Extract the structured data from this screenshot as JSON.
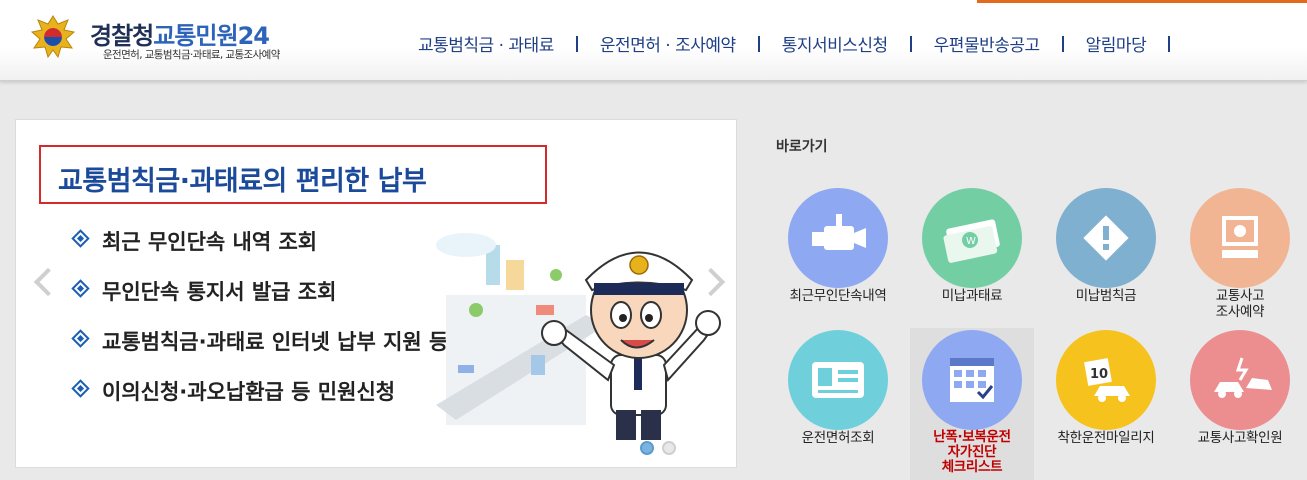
{
  "header": {
    "logo_main": "경찰청",
    "logo_accent": "교통민원24",
    "logo_subtitle": "운전면허, 교통범칙금·과태료, 교통조사예약",
    "nav": [
      "교통범칙금 · 과태료",
      "운전면허 · 조사예약",
      "통지서비스신청",
      "우편물반송공고",
      "알림마당"
    ]
  },
  "banner": {
    "title": "교통범칙금·과태료의 편리한 납부",
    "bullets": [
      "최근 무인단속 내역 조회",
      "무인단속 통지서 발급 조회",
      "교통범칙금·과태료 인터넷 납부 지원 등",
      "이의신청·과오납환급 등 민원신청"
    ],
    "slide_current": 1,
    "slide_total": 2
  },
  "quick": {
    "title": "바로가기",
    "items": [
      {
        "label": "최근무인단속내역",
        "icon": "camera-icon",
        "color": "#8ea8f2"
      },
      {
        "label": "미납과태료",
        "icon": "money-icon",
        "color": "#74cea4"
      },
      {
        "label": "미납범칙금",
        "icon": "warning-icon",
        "color": "#7fb0cf"
      },
      {
        "label": "교통사고\n조사예약",
        "icon": "monitor-icon",
        "color": "#f1b593"
      },
      {
        "label": "운전면허조회",
        "icon": "license-card-icon",
        "color": "#6fd0dc"
      },
      {
        "label": "난폭·보복운전\n자가진단\n체크리스트",
        "icon": "calendar-check-icon",
        "color": "#8ea8f2"
      },
      {
        "label": "착한운전마일리지",
        "icon": "mileage-car-icon",
        "color": "#f6c21e"
      },
      {
        "label": "교통사고확인원",
        "icon": "car-crash-icon",
        "color": "#ec8e90"
      }
    ]
  },
  "colors": {
    "nav_text": "#1f3f86",
    "title_blue": "#1b4a9a",
    "title_border": "#d52a2a",
    "highlight_label": "#c00000"
  }
}
